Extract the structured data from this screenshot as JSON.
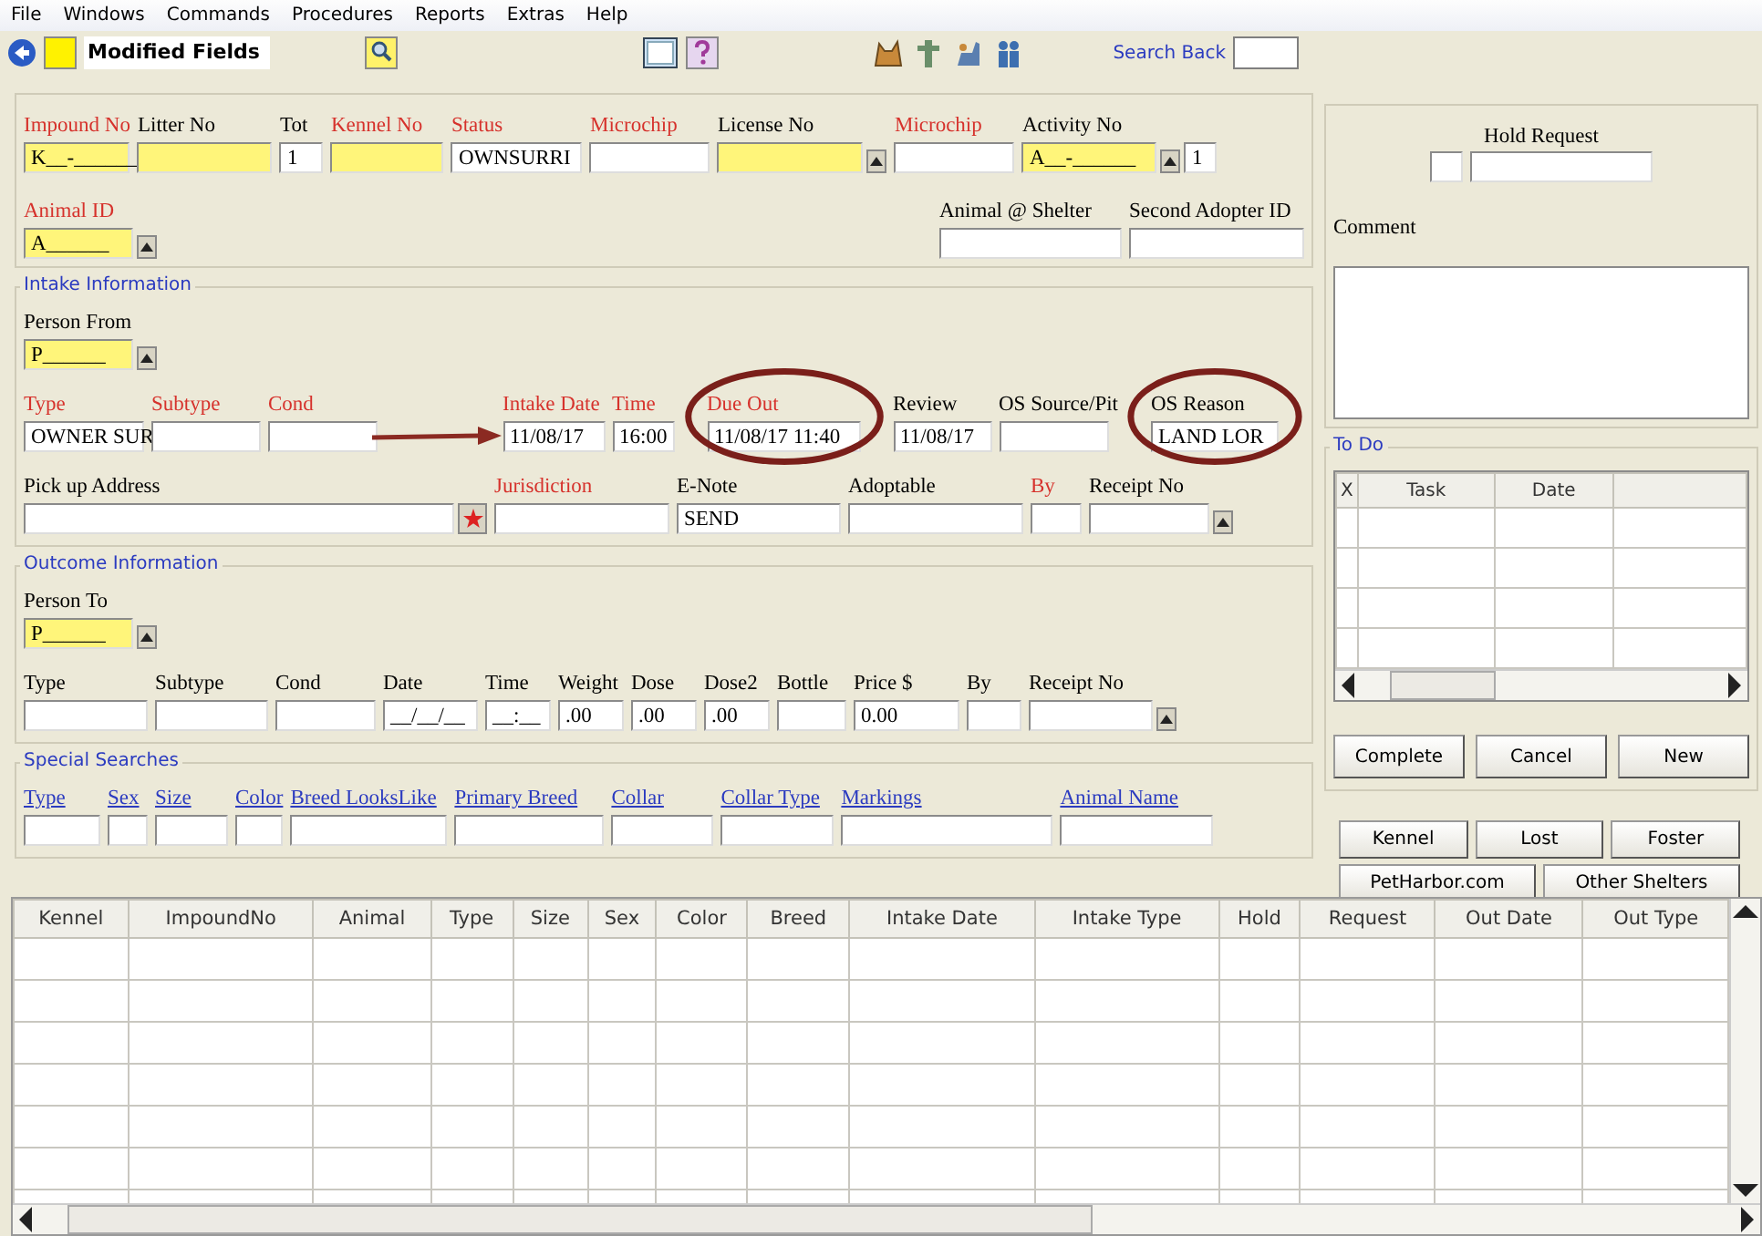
{
  "menu": [
    "File",
    "Windows",
    "Commands",
    "Procedures",
    "Reports",
    "Extras",
    "Help"
  ],
  "toolbar": {
    "title": "Modified Fields",
    "search_back": "Search Back"
  },
  "top": {
    "rows": [
      {
        "fields": [
          {
            "label": "Impound No",
            "kind": "required",
            "value": "K__-______",
            "highlighted": true
          },
          {
            "label": "Litter No",
            "kind": "normal",
            "highlighted": true
          },
          {
            "label": "Tot",
            "kind": "normal",
            "value": "1",
            "highlighted": false
          },
          {
            "label": "Kennel No",
            "kind": "required",
            "highlighted": true
          },
          {
            "label": "Status",
            "kind": "required",
            "value": "OWNSURRI",
            "highlighted": false
          },
          {
            "label": "Microchip",
            "kind": "required",
            "highlighted": false
          },
          {
            "label": "License No",
            "kind": "normal",
            "highlighted": true,
            "lookup": true
          },
          {
            "label": "Microchip",
            "kind": "required",
            "highlighted": false
          },
          {
            "label": "Activity No",
            "kind": "normal",
            "value": "A__-______",
            "highlighted": true,
            "lookup": true,
            "extra": "1"
          }
        ]
      },
      {
        "fields": [
          {
            "label": "Animal ID",
            "kind": "required",
            "value": "A______",
            "highlighted": true,
            "lookup": true
          },
          {
            "label": "Animal @ Shelter",
            "kind": "normal",
            "highlighted": false
          },
          {
            "label": "Second Adopter ID",
            "kind": "normal",
            "highlighted": false
          }
        ]
      }
    ]
  },
  "intake": {
    "title": "Intake Information",
    "rows": [
      {
        "fields": [
          {
            "label": "Person From",
            "kind": "normal",
            "value": "P______",
            "highlighted": true,
            "lookup": true
          }
        ]
      },
      {
        "fields": [
          {
            "label": "Type",
            "kind": "required",
            "value": "OWNER SUR",
            "highlighted": false
          },
          {
            "label": "Subtype",
            "kind": "required",
            "highlighted": false
          },
          {
            "label": "Cond",
            "kind": "required",
            "highlighted": false
          },
          {
            "label": "Intake Date",
            "kind": "required",
            "value": "11/08/17",
            "highlighted": false
          },
          {
            "label": "Time",
            "kind": "required",
            "value": "16:00",
            "highlighted": false
          },
          {
            "label": "Due Out",
            "kind": "required",
            "value": "11/08/17 11:40",
            "highlighted": false
          },
          {
            "label": "Review",
            "kind": "normal",
            "value": "11/08/17",
            "highlighted": false
          },
          {
            "label": "OS Source/Pit",
            "kind": "normal",
            "highlighted": false
          },
          {
            "label": "OS Reason",
            "kind": "normal",
            "value": "LAND LOR",
            "highlighted": false
          }
        ]
      },
      {
        "fields": [
          {
            "label": "Pick up Address",
            "kind": "normal",
            "highlighted": false,
            "star": true
          },
          {
            "label": "Jurisdiction",
            "kind": "required",
            "highlighted": false
          },
          {
            "label": "E-Note",
            "kind": "normal",
            "value": "SEND",
            "highlighted": false
          },
          {
            "label": "Adoptable",
            "kind": "normal",
            "highlighted": false
          },
          {
            "label": "By",
            "kind": "required",
            "highlighted": false
          },
          {
            "label": "Receipt No",
            "kind": "normal",
            "highlighted": false,
            "lookup": true
          }
        ]
      }
    ]
  },
  "outcome": {
    "title": "Outcome Information",
    "rows": [
      {
        "fields": [
          {
            "label": "Person To",
            "kind": "normal",
            "value": "P______",
            "highlighted": true,
            "lookup": true
          }
        ]
      },
      {
        "fields": [
          {
            "label": "Type",
            "kind": "normal",
            "highlighted": false
          },
          {
            "label": "Subtype",
            "kind": "normal",
            "highlighted": false
          },
          {
            "label": "Cond",
            "kind": "normal",
            "highlighted": false
          },
          {
            "label": "Date",
            "kind": "normal",
            "value": "__/__/__",
            "highlighted": false
          },
          {
            "label": "Time",
            "kind": "normal",
            "value": "__:__",
            "highlighted": false
          },
          {
            "label": "Weight",
            "kind": "normal",
            "value": ".00",
            "highlighted": false
          },
          {
            "label": "Dose",
            "kind": "normal",
            "value": ".00",
            "highlighted": false
          },
          {
            "label": "Dose2",
            "kind": "normal",
            "value": ".00",
            "highlighted": false
          },
          {
            "label": "Bottle",
            "kind": "normal",
            "highlighted": false
          },
          {
            "label": "Price $",
            "kind": "normal",
            "value": "0.00",
            "highlighted": false
          },
          {
            "label": "By",
            "kind": "normal",
            "highlighted": false
          },
          {
            "label": "Receipt No",
            "kind": "normal",
            "highlighted": false,
            "lookup": true
          }
        ]
      }
    ]
  },
  "special": {
    "title": "Special Searches",
    "rows": [
      {
        "fields": [
          {
            "label": "Type",
            "kind": "link",
            "highlighted": false
          },
          {
            "label": "Sex",
            "kind": "link",
            "highlighted": false
          },
          {
            "label": "Size",
            "kind": "link",
            "highlighted": false
          },
          {
            "label": "Color",
            "kind": "link",
            "highlighted": false
          },
          {
            "label": "Breed LooksLike",
            "kind": "link",
            "highlighted": false
          },
          {
            "label": "Primary Breed",
            "kind": "link",
            "highlighted": false
          },
          {
            "label": "Collar",
            "kind": "link",
            "highlighted": false
          },
          {
            "label": "Collar Type",
            "kind": "link",
            "highlighted": false
          },
          {
            "label": "Markings",
            "kind": "link",
            "highlighted": false
          },
          {
            "label": "Animal Name",
            "kind": "link",
            "highlighted": false
          }
        ]
      }
    ]
  },
  "hold_request": {
    "label": "Hold Request"
  },
  "comment": {
    "label": "Comment"
  },
  "todo": {
    "title": "To Do",
    "columns": [
      "X",
      "Task",
      "Date"
    ],
    "buttons": [
      "Complete",
      "Cancel",
      "New"
    ]
  },
  "search_buttons": [
    "Kennel",
    "Lost",
    "Foster",
    "PetHarbor.com",
    "Other Shelters"
  ],
  "table": {
    "columns": [
      "Kennel",
      "ImpoundNo",
      "Animal",
      "Type",
      "Size",
      "Sex",
      "Color",
      "Breed",
      "Intake Date",
      "Intake Type",
      "Hold",
      "Request",
      "Out Date",
      "Out Type"
    ]
  },
  "annotations": [
    {
      "kind": "ellipse"
    },
    {
      "kind": "ellipse"
    },
    {
      "kind": "arrow"
    }
  ]
}
